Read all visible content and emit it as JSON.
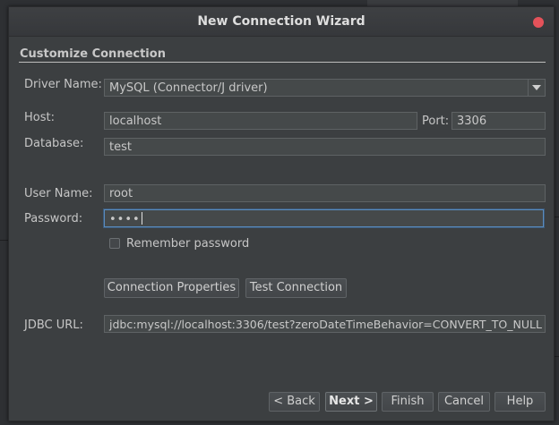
{
  "window": {
    "title": "New Connection Wizard"
  },
  "section": {
    "title": "Customize Connection"
  },
  "form": {
    "driver_label": "Driver Name:",
    "driver_value": "MySQL (Connector/J driver)",
    "host_label": "Host:",
    "host_value": "localhost",
    "port_label": "Port:",
    "port_value": "3306",
    "database_label": "Database:",
    "database_value": "test",
    "username_label": "User Name:",
    "username_value": "root",
    "password_label": "Password:",
    "password_value": "••••",
    "remember_label": "Remember password",
    "remember_checked": false,
    "jdbc_label": "JDBC URL:",
    "jdbc_value": "jdbc:mysql://localhost:3306/test?zeroDateTimeBehavior=CONVERT_TO_NULL"
  },
  "actions": {
    "connection_properties": "Connection Properties",
    "test_connection": "Test Connection"
  },
  "footer": {
    "back": "< Back",
    "next": "Next >",
    "finish": "Finish",
    "cancel": "Cancel",
    "help": "Help"
  },
  "colors": {
    "dialog_bg": "#3c3f41",
    "field_bg": "#45494a",
    "close_button": "#e4525a",
    "focus_border": "#5a8cbf"
  }
}
